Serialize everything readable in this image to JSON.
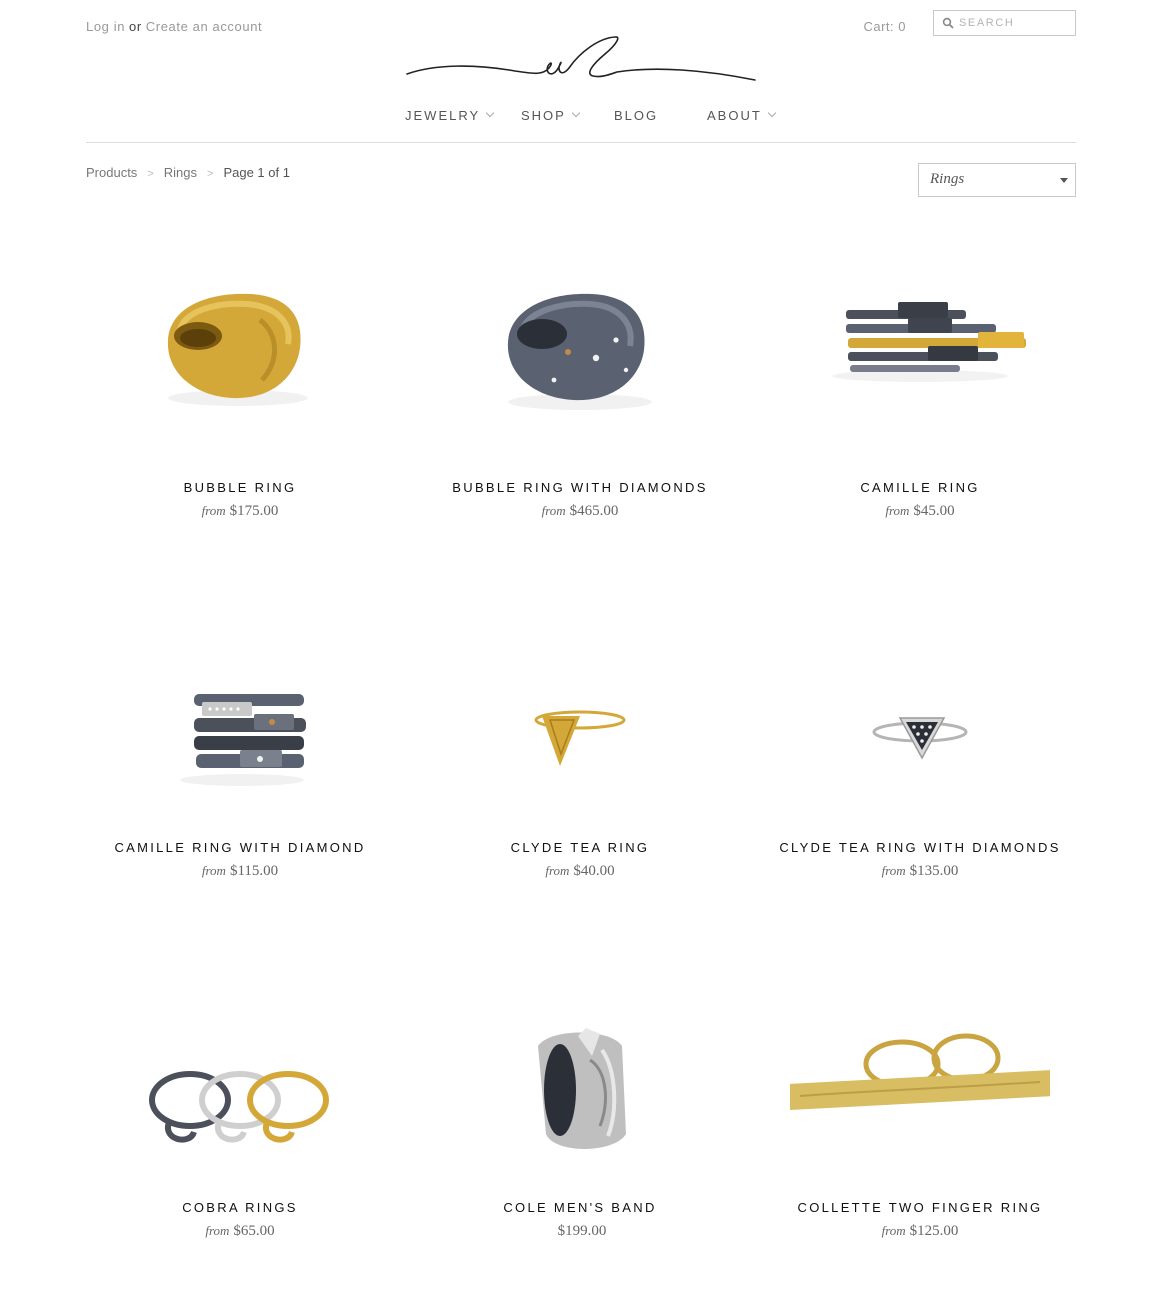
{
  "header": {
    "login_label": "Log in",
    "or_label": "or",
    "create_account_label": "Create an account",
    "cart_label": "Cart: 0",
    "search_placeholder": "SEARCH",
    "logo_icon": "vl-signature-logo"
  },
  "nav": {
    "items": [
      {
        "label": "JEWELRY",
        "has_dropdown": true
      },
      {
        "label": "SHOP",
        "has_dropdown": true
      },
      {
        "label": "BLOG",
        "has_dropdown": false
      },
      {
        "label": "ABOUT",
        "has_dropdown": true
      }
    ]
  },
  "breadcrumb": {
    "items": [
      "Products",
      "Rings",
      "Page 1 of 1"
    ],
    "separator": ">"
  },
  "filter": {
    "selected": "Rings"
  },
  "products": [
    {
      "name": "BUBBLE RING",
      "from_label": "from",
      "price": "$175.00",
      "image": "gold-dome-ring"
    },
    {
      "name": "BUBBLE RING WITH DIAMONDS",
      "from_label": "from",
      "price": "$465.00",
      "image": "oxidized-dome-ring-diamonds"
    },
    {
      "name": "CAMILLE RING",
      "from_label": "from",
      "price": "$45.00",
      "image": "stacked-bar-rings"
    },
    {
      "name": "CAMILLE RING WITH DIAMOND",
      "from_label": "from",
      "price": "$115.00",
      "image": "stacked-oxidized-rings-diamond"
    },
    {
      "name": "CLYDE TEA RING",
      "from_label": "from",
      "price": "$40.00",
      "image": "gold-triangle-ring"
    },
    {
      "name": "CLYDE TEA RING WITH DIAMONDS",
      "from_label": "from",
      "price": "$135.00",
      "image": "silver-triangle-diamond-ring"
    },
    {
      "name": "COBRA RINGS",
      "from_label": "from",
      "price": "$65.00",
      "image": "coiled-rings-trio"
    },
    {
      "name": "COLE MEN'S BAND",
      "from_label": "",
      "price": "$199.00",
      "image": "textured-silver-band"
    },
    {
      "name": "COLLETTE TWO FINGER RING",
      "from_label": "from",
      "price": "$125.00",
      "image": "gold-two-finger-bar-ring"
    }
  ],
  "colors": {
    "gold": "#d4a838",
    "gold_dark": "#a87d1e",
    "oxidized": "#5a6170",
    "silver": "#c8c8c8",
    "text_muted": "#999999",
    "rule": "#dcdcdc"
  }
}
